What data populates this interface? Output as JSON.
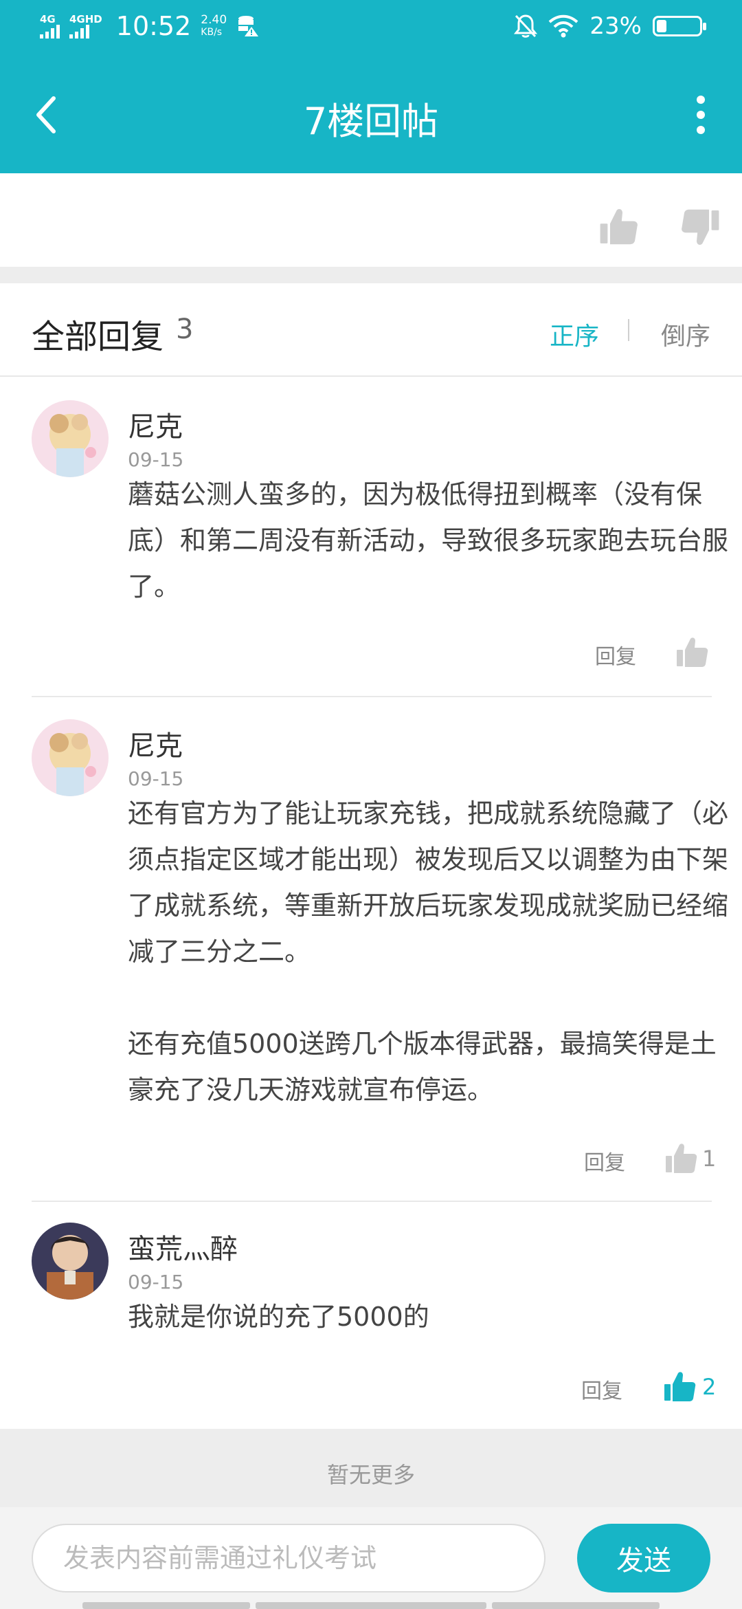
{
  "status_bar": {
    "sim1": "4G",
    "sim2": "4GHD",
    "time": "10:52",
    "net_speed_value": "2.40",
    "net_speed_unit": "KB/s",
    "battery_percent": "23%",
    "battery_level": 0.23,
    "icons": [
      "signal-icon",
      "data-saver-icon",
      "mute-icon",
      "wifi-icon",
      "battery-icon"
    ]
  },
  "header": {
    "title": "7楼回帖",
    "back_icon": "chevron-left-icon",
    "more_icon": "more-vertical-icon"
  },
  "replies_section": {
    "title": "全部回复",
    "count": "3",
    "sort_ascending": "正序",
    "sort_descending": "倒序"
  },
  "replies": [
    {
      "author": "尼克",
      "date": "09-15",
      "content": "蘑菇公测人蛮多的，因为极低得扭到概率（没有保底）和第二周没有新活动，导致很多玩家跑去玩台服了。",
      "reply_label": "回复",
      "likes": "",
      "liked": false
    },
    {
      "author": "尼克",
      "date": "09-15",
      "content": "还有官方为了能让玩家充钱，把成就系统隐藏了（必须点指定区域才能出现）被发现后又以调整为由下架了成就系统，等重新开放后玩家发现成就奖励已经缩减了三分之二。\n\n还有充值5000送跨几个版本得武器，最搞笑得是土豪充了没几天游戏就宣布停运。",
      "reply_label": "回复",
      "likes": "1",
      "liked": false
    },
    {
      "author": "蛮荒灬醉",
      "date": "09-15",
      "content": "我就是你说的充了5000的",
      "reply_label": "回复",
      "likes": "2",
      "liked": true
    }
  ],
  "footer": {
    "no_more": "暂无更多",
    "input_placeholder": "发表内容前需通过礼仪考试",
    "send_label": "发送"
  },
  "colors": {
    "accent": "#17b5c6",
    "muted_icon": "#cfcfcf"
  }
}
